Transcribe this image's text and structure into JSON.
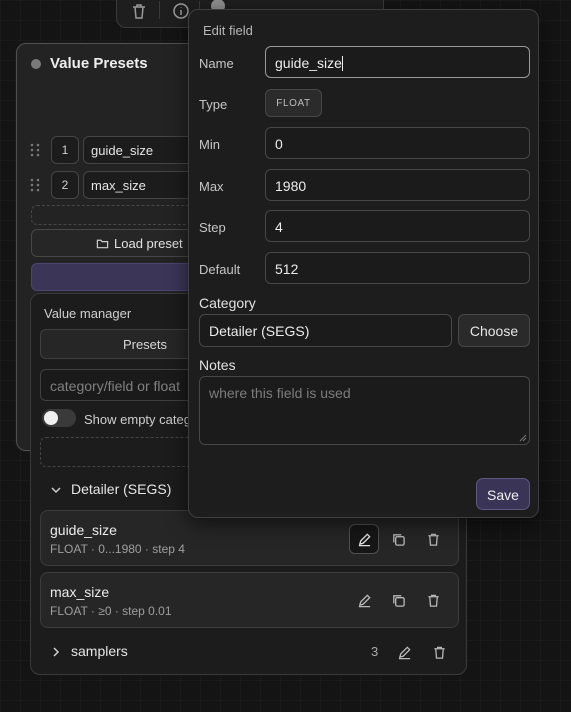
{
  "node": {
    "title": "Value Presets",
    "presets": [
      {
        "index": "1",
        "name": "guide_size"
      },
      {
        "index": "2",
        "name": "max_size"
      }
    ],
    "load_preset_label": "Load preset"
  },
  "value_manager": {
    "title": "Value manager",
    "presets_label": "Presets",
    "search_placeholder": "category/field or float",
    "show_empty_label": "Show empty categ",
    "categories": [
      {
        "name": "Detailer (SEGS)",
        "expanded": true,
        "fields": [
          {
            "name": "guide_size",
            "meta": "FLOAT · 0...1980 · step 4"
          },
          {
            "name": "max_size",
            "meta": "FLOAT · ≥0 · step 0.01"
          }
        ]
      },
      {
        "name": "samplers",
        "expanded": false,
        "count": "3"
      }
    ]
  },
  "edit_field": {
    "title": "Edit field",
    "name_label": "Name",
    "name_value": "guide_size",
    "type_label": "Type",
    "type_value": "FLOAT",
    "min_label": "Min",
    "min_value": "0",
    "max_label": "Max",
    "max_value": "1980",
    "step_label": "Step",
    "step_value": "4",
    "default_label": "Default",
    "default_value": "512",
    "category_label": "Category",
    "category_value": "Detailer (SEGS)",
    "choose_label": "Choose",
    "notes_label": "Notes",
    "notes_placeholder": "where this field is used",
    "save_label": "Save"
  },
  "colors": {
    "accent": "#3a3456",
    "background": "#141414",
    "panel": "#1d1d1d"
  }
}
